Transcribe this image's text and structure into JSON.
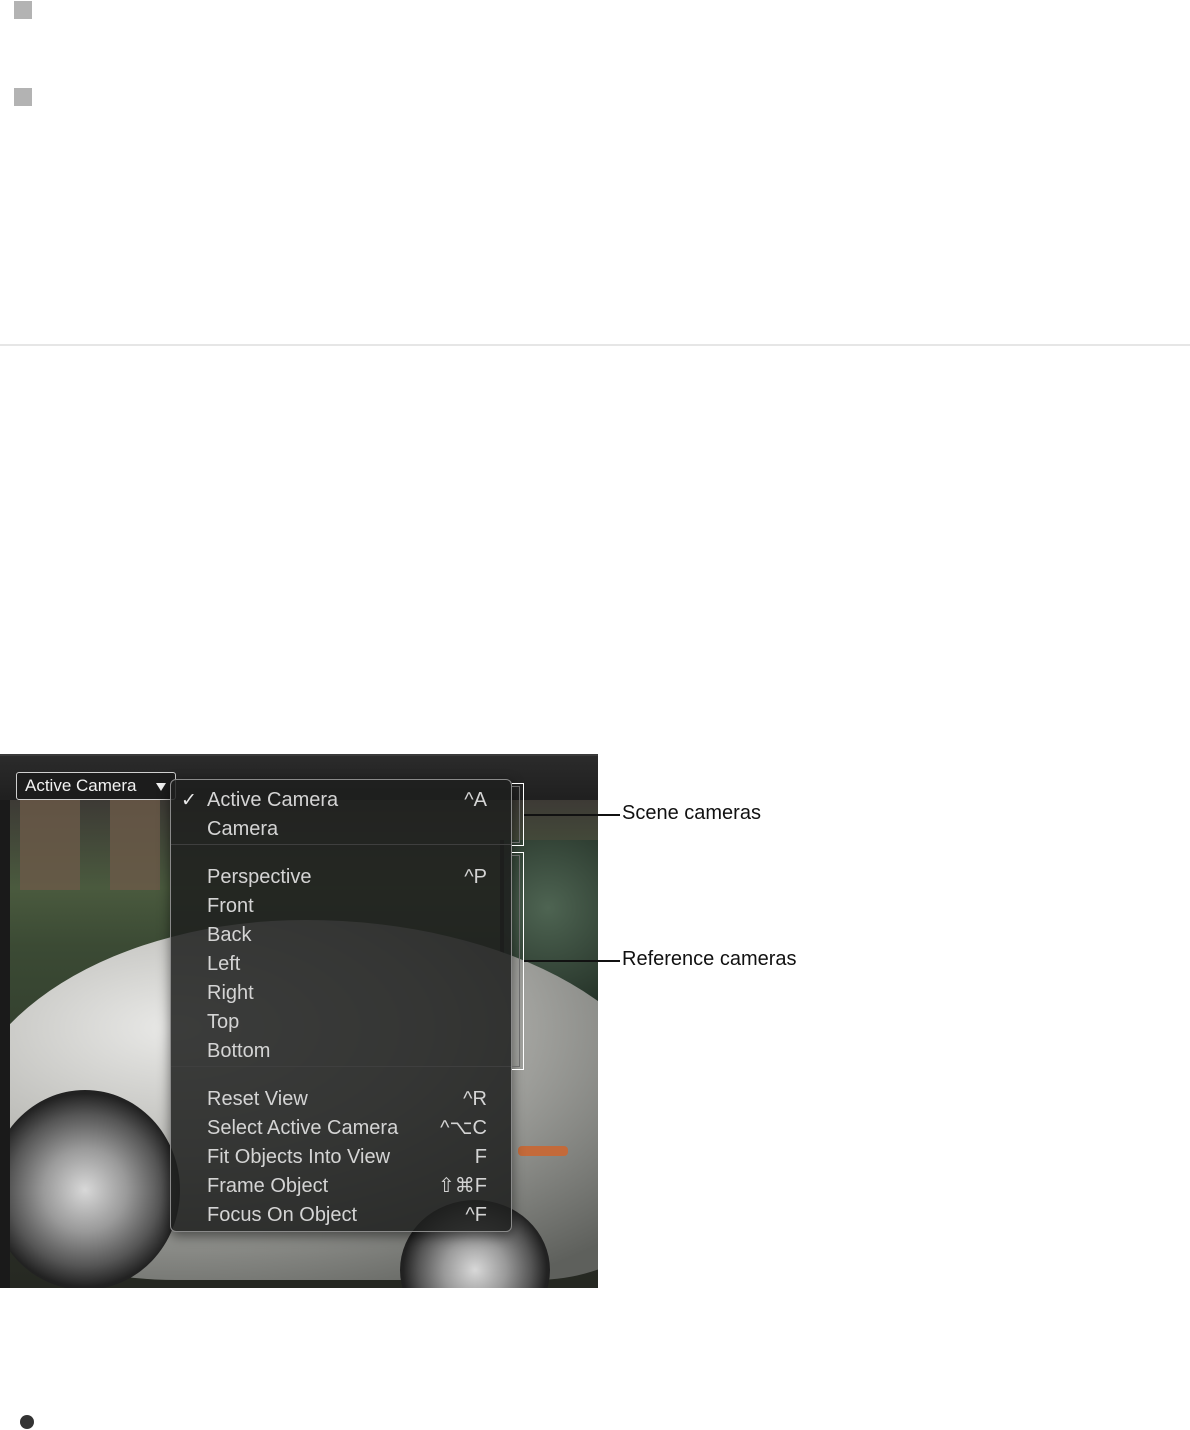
{
  "viewer": {
    "popup_label": "Active Camera"
  },
  "menu": {
    "checked_symbol": "✓",
    "groups": [
      [
        {
          "label": "Active Camera",
          "shortcut": "^A",
          "checked": true
        },
        {
          "label": "Camera",
          "shortcut": "",
          "checked": false
        }
      ],
      [
        {
          "label": "Perspective",
          "shortcut": "^P",
          "checked": false
        },
        {
          "label": "Front",
          "shortcut": "",
          "checked": false
        },
        {
          "label": "Back",
          "shortcut": "",
          "checked": false
        },
        {
          "label": "Left",
          "shortcut": "",
          "checked": false
        },
        {
          "label": "Right",
          "shortcut": "",
          "checked": false
        },
        {
          "label": "Top",
          "shortcut": "",
          "checked": false
        },
        {
          "label": "Bottom",
          "shortcut": "",
          "checked": false
        }
      ],
      [
        {
          "label": "Reset View",
          "shortcut": "^R",
          "checked": false
        },
        {
          "label": "Select Active Camera",
          "shortcut": "^⌥C",
          "checked": false
        },
        {
          "label": "Fit Objects Into View",
          "shortcut": "F",
          "checked": false
        },
        {
          "label": "Frame Object",
          "shortcut": "⇧⌘F",
          "checked": false
        },
        {
          "label": "Focus On Object",
          "shortcut": "^F",
          "checked": false
        }
      ]
    ]
  },
  "callouts": {
    "scene": "Scene cameras",
    "reference": "Reference cameras"
  },
  "colors": {
    "menu_text": "#d4d4d4",
    "menu_bg": "#1e1f1e",
    "callout_text": "#111111"
  }
}
